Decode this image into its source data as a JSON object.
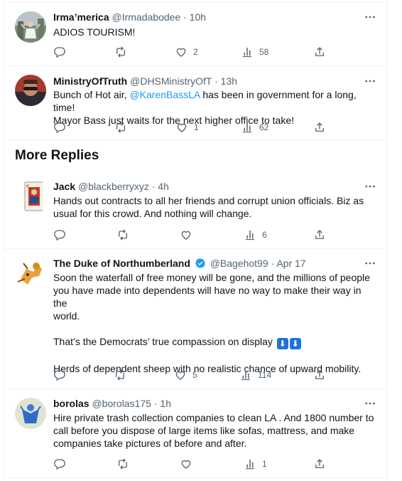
{
  "section": {
    "title": "More Replies"
  },
  "tweets": [
    {
      "name": "Irma’merica",
      "handle": "@Irmadabodee",
      "time": "10h",
      "lines": [
        "ADIOS TOURISM!"
      ],
      "stats": {
        "replies": "",
        "retweets": "",
        "likes": "2",
        "views": "58"
      }
    },
    {
      "name": "MinistryOfTruth",
      "handle": "@DHSMinistryOfT",
      "time": "13h",
      "text_prefix": "Bunch of Hot air, ",
      "mention": "@KarenBassLA",
      "text_suffix": " has been in government for a long, time!",
      "line2": "Mayor Bass just waits for the next higher office to take!",
      "stats": {
        "replies": "",
        "retweets": "",
        "likes": "1",
        "views": "62"
      }
    },
    {
      "name": "Jack",
      "handle": "@blackberryxyz",
      "time": "4h",
      "lines": [
        "Hands out contracts to all her friends and corrupt union officials. Biz as",
        "usual for this crowd. And nothing will change."
      ],
      "stats": {
        "replies": "",
        "retweets": "",
        "likes": "",
        "views": "6"
      }
    },
    {
      "name": "The Duke of Northumberland",
      "handle": "@Bagehot99",
      "time": "Apr 17",
      "lines": [
        "Soon the waterfall of free money will be gone, and the millions of people",
        "you have made into dependents will have no way to make their way in the",
        "world."
      ],
      "line_compassion": "That’s the Democrats’ true compassion on display",
      "line_herds": "Herds of dependent sheep with no realistic chance of upward mobility.",
      "stats": {
        "replies": "",
        "retweets": "",
        "likes": "5",
        "views": "114"
      }
    },
    {
      "name": "borolas",
      "handle": "@borolas175",
      "time": "1h",
      "lines": [
        "Hire private trash collection companies to clean LA . And 1800 number to",
        "call before you dispose of large items like sofas, mattress, and make",
        "companies take pictures of before and after."
      ],
      "stats": {
        "replies": "",
        "retweets": "",
        "likes": "",
        "views": "1"
      }
    }
  ],
  "separator": "·",
  "icons": [
    "reply-icon",
    "retweet-icon",
    "like-icon",
    "views-icon",
    "share-icon",
    "more-icon",
    "verified-icon"
  ],
  "colors": {
    "text": "#0f1419",
    "secondary": "#536471",
    "link": "#1d9bf0",
    "border": "#eff3f4"
  }
}
